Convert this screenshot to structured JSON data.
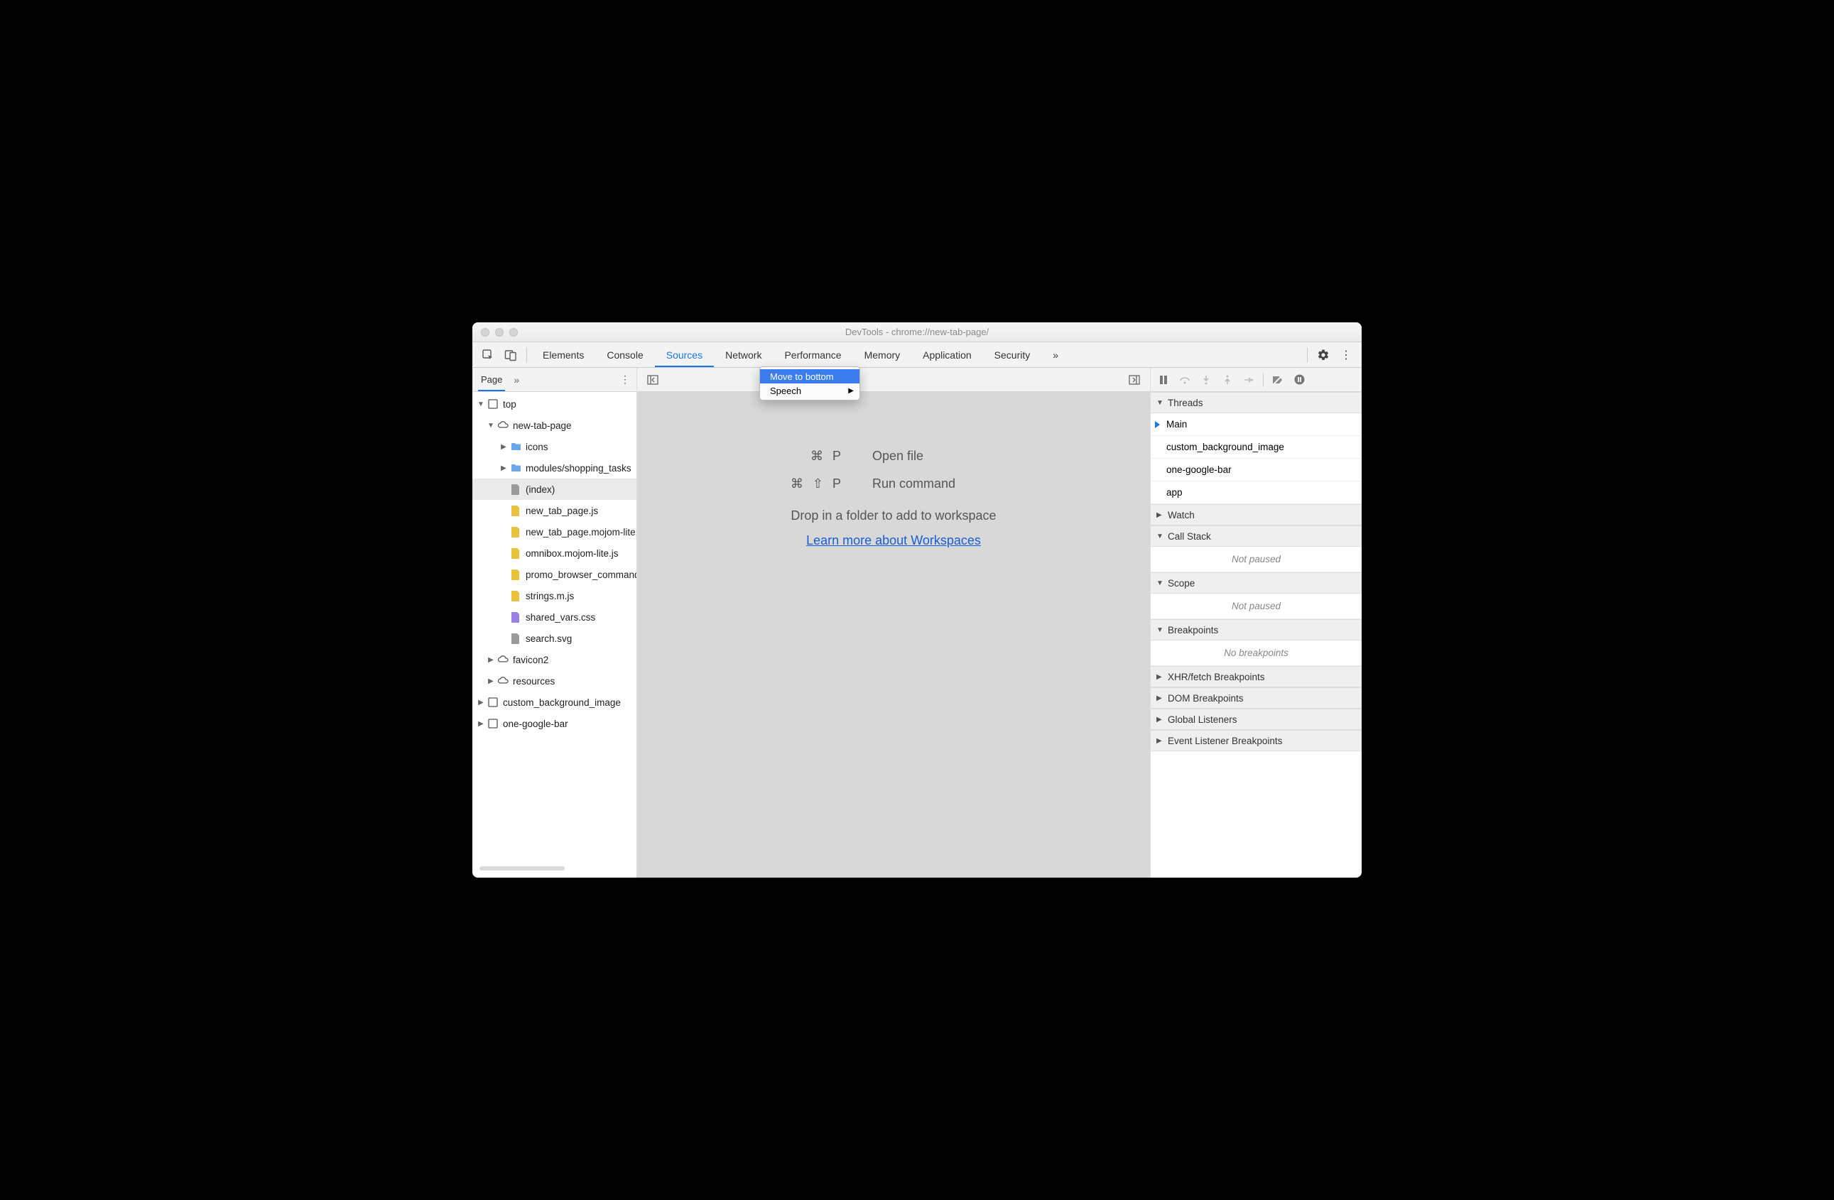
{
  "window": {
    "title": "DevTools - chrome://new-tab-page/"
  },
  "toolbar": {
    "tabs": [
      "Elements",
      "Console",
      "Sources",
      "Network",
      "Performance",
      "Memory",
      "Application",
      "Security"
    ],
    "activeTab": "Sources",
    "more": "»"
  },
  "leftPanel": {
    "tab": "Page",
    "more": "»",
    "tree": {
      "top": "top",
      "newTab": "new-tab-page",
      "icons": "icons",
      "modules": "modules/shopping_tasks",
      "index": "(index)",
      "js1": "new_tab_page.js",
      "js2": "new_tab_page.mojom-lite.js",
      "js3": "omnibox.mojom-lite.js",
      "js4": "promo_browser_command.mojom-lite.js",
      "js5": "strings.m.js",
      "css1": "shared_vars.css",
      "svg1": "search.svg",
      "fav": "favicon2",
      "res": "resources",
      "cbg": "custom_background_image",
      "ogb": "one-google-bar"
    }
  },
  "contextMenu": {
    "item1": "Move to bottom",
    "item2": "Speech"
  },
  "center": {
    "openFileKey": "⌘ P",
    "openFile": "Open file",
    "runCmdKey": "⌘ ⇧ P",
    "runCmd": "Run command",
    "drop": "Drop in a folder to add to workspace",
    "learn": "Learn more about Workspaces"
  },
  "rightPanel": {
    "threads": "Threads",
    "t1": "Main",
    "t2": "custom_background_image",
    "t3": "one-google-bar",
    "t4": "app",
    "watch": "Watch",
    "callstack": "Call Stack",
    "notpaused": "Not paused",
    "scope": "Scope",
    "breakpoints": "Breakpoints",
    "nobreak": "No breakpoints",
    "xhr": "XHR/fetch Breakpoints",
    "dom": "DOM Breakpoints",
    "global": "Global Listeners",
    "event": "Event Listener Breakpoints"
  }
}
